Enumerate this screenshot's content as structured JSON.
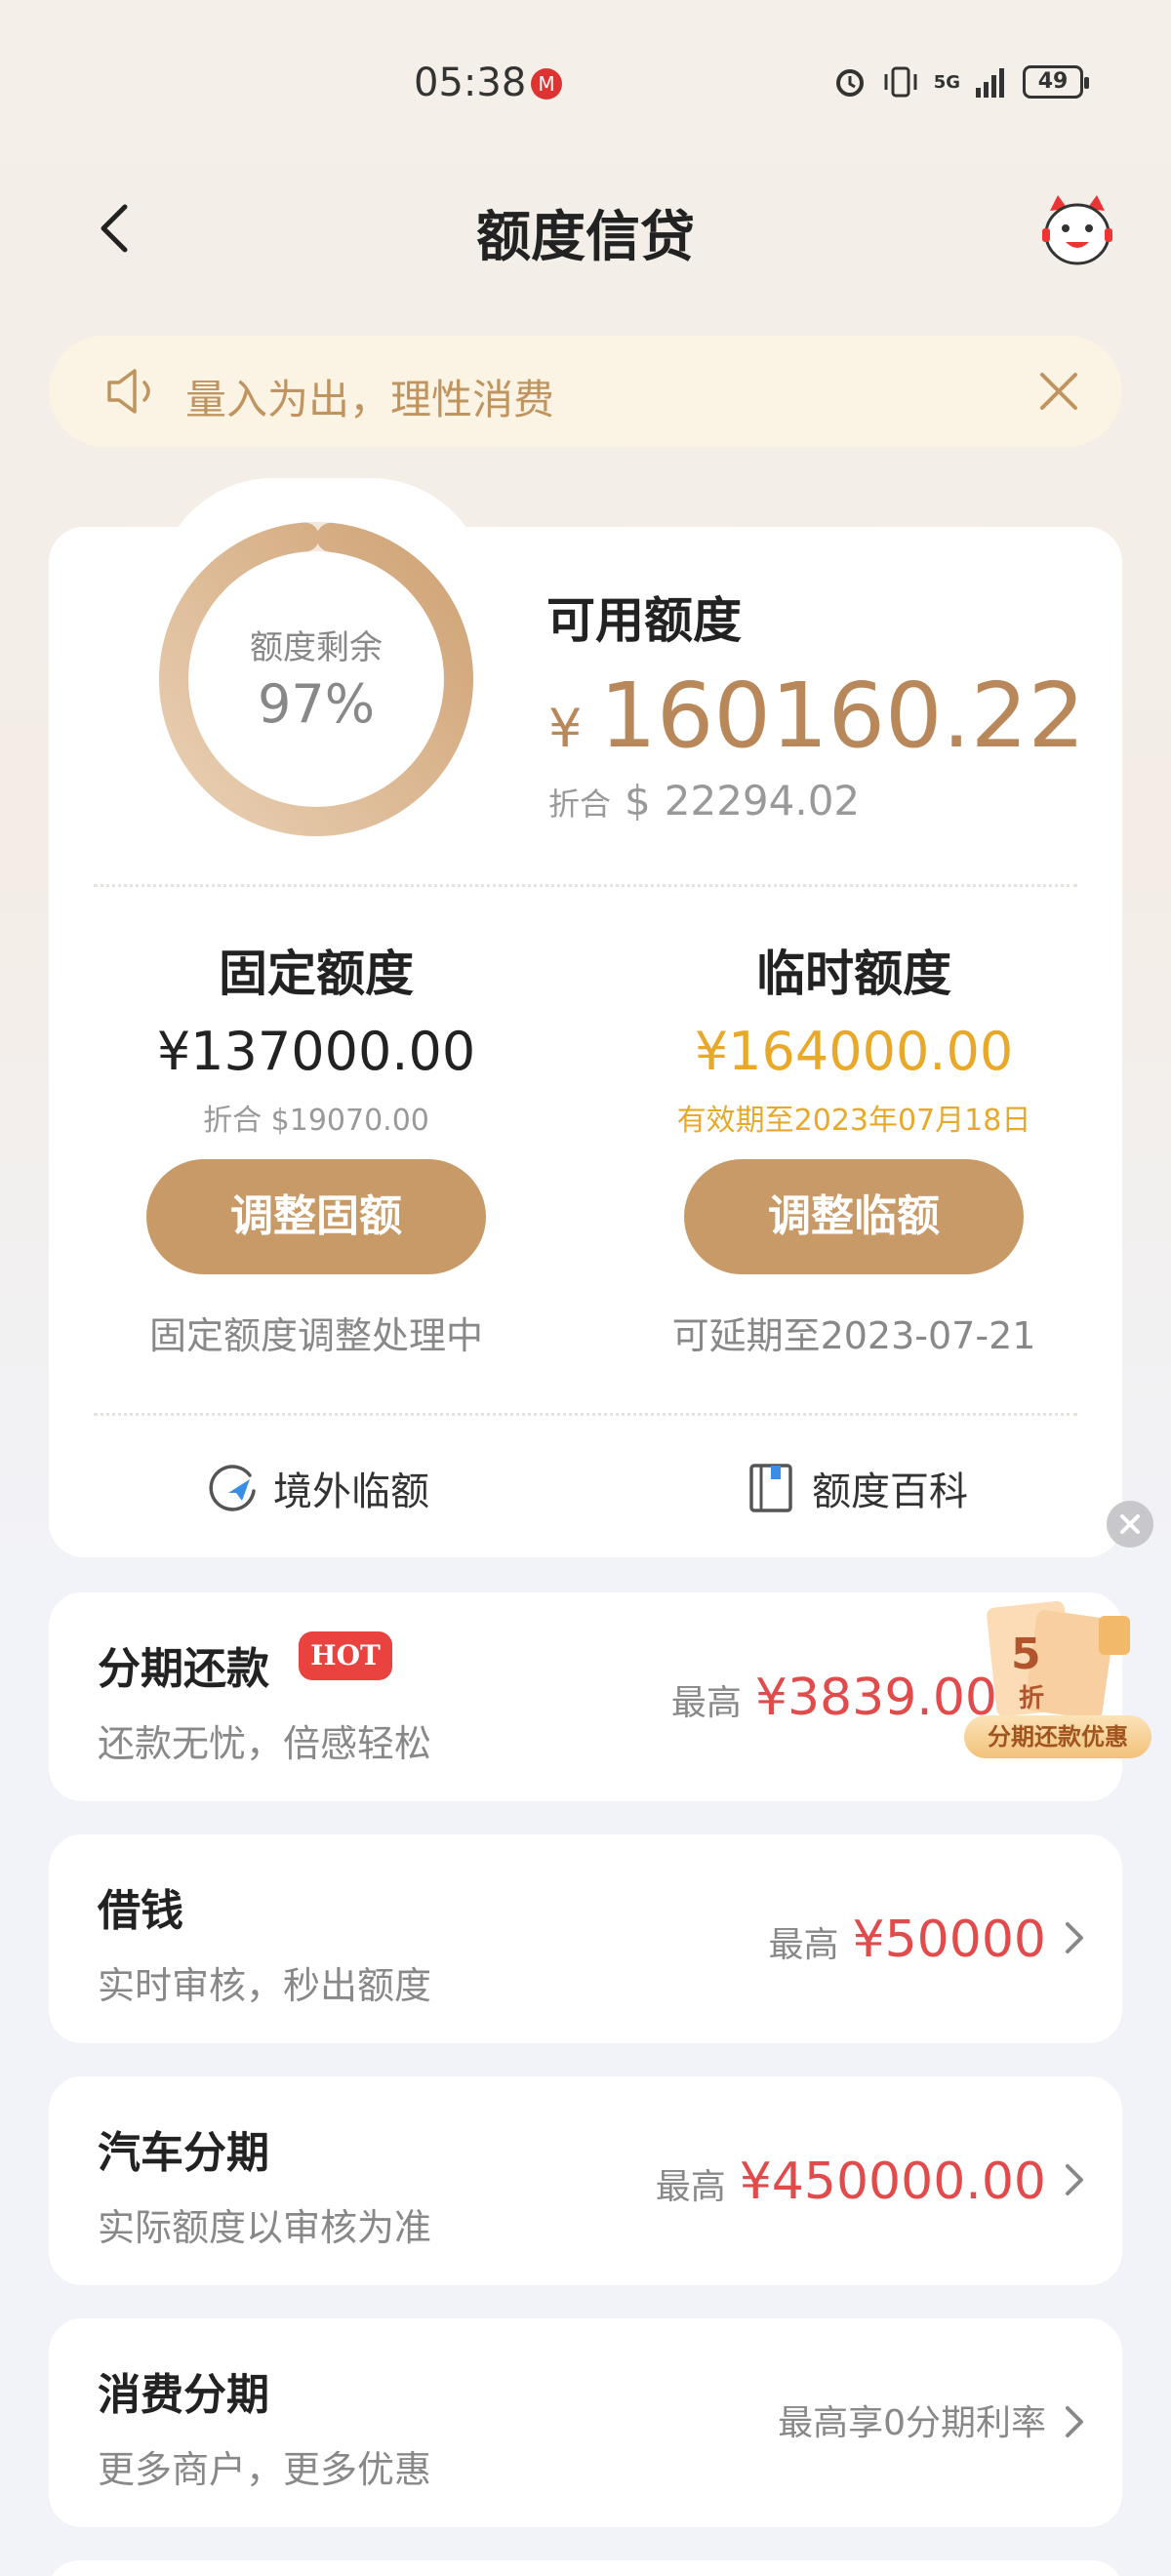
{
  "status_bar": {
    "time": "05:38",
    "network": "5G",
    "battery": "49"
  },
  "header": {
    "title": "额度信贷"
  },
  "notice": {
    "text": "量入为出，理性消费"
  },
  "credit": {
    "ring_label": "额度剩余",
    "remaining_percent": "97%",
    "remaining_fraction": 0.97,
    "available_label": "可用额度",
    "currency_symbol": "¥",
    "available_amount": "160160.22",
    "conversion_label": "折合",
    "usd_symbol": "$",
    "available_usd": "22294.02"
  },
  "fixed": {
    "title": "固定额度",
    "amount": "¥137000.00",
    "conversion": "折合 $19070.00",
    "button": "调整固额",
    "note": "固定额度调整处理中"
  },
  "temporary": {
    "title": "临时额度",
    "amount": "¥164000.00",
    "validity": "有效期至2023年07月18日",
    "button": "调整临额",
    "note": "可延期至2023-07-21"
  },
  "links": {
    "overseas": "境外临额",
    "encyclopedia": "额度百科"
  },
  "rows": [
    {
      "title": "分期还款",
      "badge": "HOT",
      "subtitle": "还款无忧，倍感轻松",
      "prefix": "最高",
      "amount": "¥3839.00"
    },
    {
      "title": "借钱",
      "subtitle": "实时审核，秒出额度",
      "prefix": "最高",
      "amount": "¥50000"
    },
    {
      "title": "汽车分期",
      "subtitle": "实际额度以审核为准",
      "prefix": "最高",
      "amount": "¥450000.00"
    },
    {
      "title": "消费分期",
      "subtitle": "更多商户，更多优惠",
      "prefix": "最高享0分期利率",
      "amount": ""
    }
  ],
  "coupon": {
    "number": "5",
    "unit": "折",
    "label": "分期还款优惠"
  },
  "colors": {
    "accent_gold": "#c89a68",
    "temp_amount": "#e8a92b",
    "red_amount": "#e14b4b",
    "hot_badge": "#e9423f"
  }
}
